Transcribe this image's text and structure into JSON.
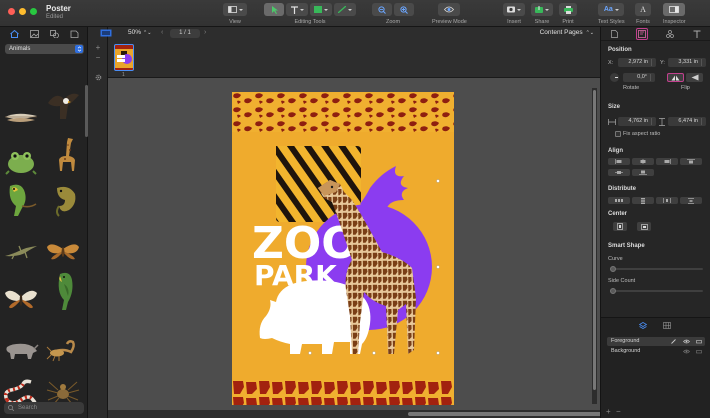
{
  "window": {
    "title": "Poster",
    "subtitle": "Edited"
  },
  "toolbar": {
    "view_label": "View",
    "tools_label": "Editing Tools",
    "zoom_label": "Zoom",
    "preview_label": "Preview Mode",
    "insert_label": "Insert",
    "share_label": "Share",
    "print_label": "Print",
    "textstyles_label": "Text Styles",
    "fonts_label": "Fonts",
    "inspector_label": "Inspector"
  },
  "sidebar": {
    "category": "Animals",
    "search_placeholder": "Search",
    "items": [
      "feathers",
      "eagle",
      "frog",
      "giraffe",
      "parrot",
      "chameleon",
      "lizard",
      "moth",
      "butterfly",
      "parrot-green",
      "rhino",
      "scorpion",
      "snake",
      "spider"
    ]
  },
  "pagestrip": {
    "zoom": "50%",
    "page_count": "1 / 1",
    "view_mode": "Content Pages",
    "thumb_number": "1"
  },
  "poster": {
    "line1": "ZOO",
    "line2": "PARK"
  },
  "inspector": {
    "position_title": "Position",
    "x_label": "X:",
    "x_value": "2,972 in",
    "y_label": "Y:",
    "y_value": "3,331 in",
    "rotate_value": "0,0°",
    "rotate_label": "Rotate",
    "flip_label": "Flip",
    "size_title": "Size",
    "w_value": "4,762 in",
    "h_value": "6,474 in",
    "aspect_label": "Fix aspect ratio",
    "align_title": "Align",
    "distribute_title": "Distribute",
    "center_title": "Center",
    "smartshape_title": "Smart Shape",
    "curve_label": "Curve",
    "sidecount_label": "Side Count"
  },
  "layers": [
    {
      "name": "Foreground"
    },
    {
      "name": "Background"
    }
  ],
  "colors": {
    "poster_bg": "#efab2d",
    "purple": "#8b3cf0",
    "accent_pink": "#c2408e",
    "selection_blue": "#2f6fe0",
    "stripe_red": "#a2220f"
  }
}
